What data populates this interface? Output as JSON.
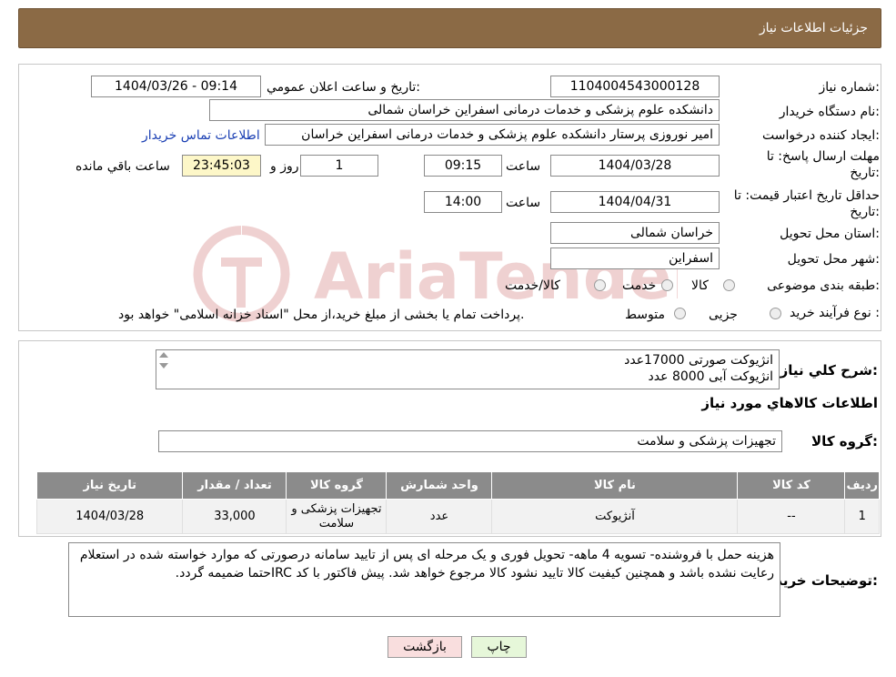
{
  "header": {
    "title": "جزئیات اطلاعات نیاز"
  },
  "fields": {
    "need_number_label": "شماره نیاز:",
    "need_number": "1104004543000128",
    "announce_label": "تاریخ و ساعت اعلان عمومي:",
    "announce_value": "1404/03/26 - 09:14",
    "buyer_label": "نام دستگاه خریدار:",
    "buyer_value": "دانشکده علوم پزشکی و خدمات درمانی اسفراین خراسان شمالی",
    "creator_label": "ایجاد کننده درخواست:",
    "creator_value": "امیر  نوروزی  پرستار  دانشکده علوم پزشکی و خدمات درمانی اسفراین خراسان",
    "contact_link": "اطلاعات تماس خریدار",
    "deadline_label": "مهلت ارسال پاسخ: تا تاریخ:",
    "deadline_date": "1404/03/28",
    "time_label": "ساعت",
    "deadline_time": "09:15",
    "days_value": "1",
    "day_and_label": "روز و",
    "remaining_time": "23:45:03",
    "remaining_label": "ساعت باقي مانده",
    "validity_label": "حداقل تاریخ اعتبار قیمت: تا تاریخ:",
    "validity_date": "1404/04/31",
    "validity_time_label": "ساعت",
    "validity_time": "14:00",
    "province_label": "استان محل تحویل:",
    "province_value": "خراسان شمالی",
    "city_label": "شهر محل تحویل:",
    "city_value": "اسفراین",
    "category_label": "طبقه بندی موضوعی:",
    "category_options": [
      "کالا",
      "خدمت",
      "کالا/خدمت"
    ],
    "process_label": "نوع فرآیند خرید :",
    "process_options": [
      "جزیی",
      "متوسط"
    ],
    "process_note": "پرداخت تمام یا بخشی از مبلغ خرید،از محل \"اسناد خزانه اسلامی\" خواهد بود."
  },
  "summary": {
    "label": "شرح کلي نیاز:",
    "line1": "انژیوکت صورتی 17000عدد",
    "line2": "انژیوکت آبی 8000 عدد"
  },
  "goods": {
    "section_title": "اطلاعات کالاهاي مورد نیاز",
    "group_label": "گروه کالا:",
    "group_value": "تجهیزات پزشکی و سلامت",
    "columns": [
      "ردیف",
      "کد کالا",
      "نام کالا",
      "واحد شمارش",
      "گروه کالا",
      "تعداد / مقدار",
      "تاریخ نیاز"
    ],
    "row": [
      "1",
      "--",
      "آنژیوکت",
      "عدد",
      "تجهیزات پزشکی و سلامت",
      "33,000",
      "1404/03/28"
    ]
  },
  "buyer_notes": {
    "label": "توضیحات خریدار:",
    "text": "هزینه حمل با فروشنده- تسویه 4 ماهه- تحویل فوری و یک مرحله ای پس از تایید سامانه درصورتی که موارد خواسته شده در استعلام رعایت نشده باشد و همچنین کیفیت کالا تایید نشود کالا مرجوع خواهد شد. پیش فاکتور با کد IRCحتما ضمیمه گردد."
  },
  "buttons": {
    "print": "چاپ",
    "back": "بازگشت"
  },
  "colors": {
    "header": "#8b6a45",
    "table_header": "#8b8b8b",
    "print_btn": "#e6f7d9",
    "back_btn": "#f9dede",
    "timer_bg": "#fdf7c8"
  }
}
